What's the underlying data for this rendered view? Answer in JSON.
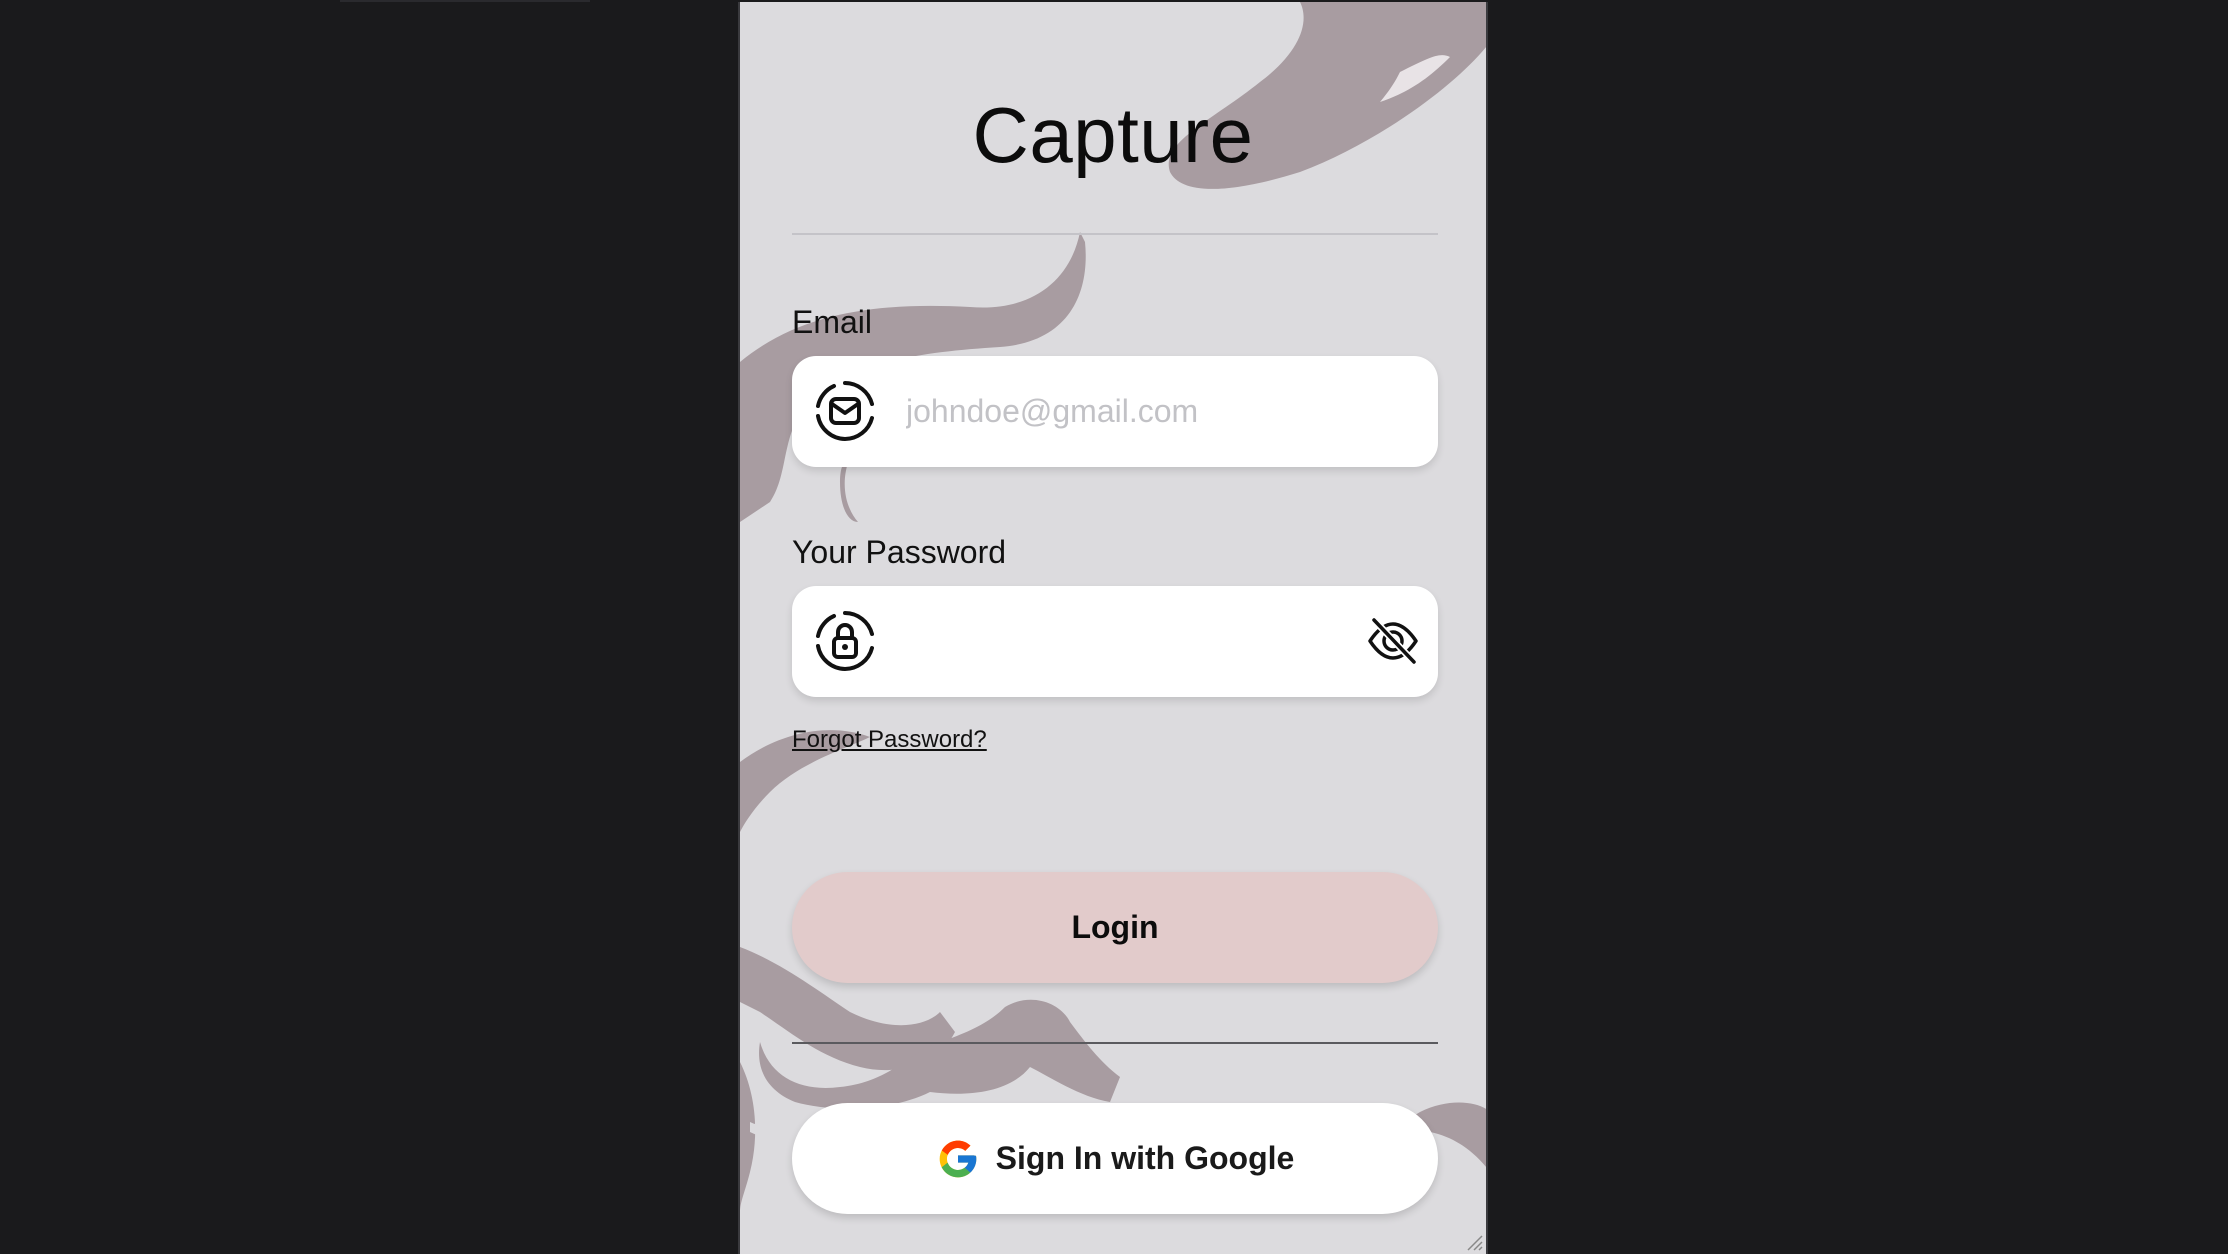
{
  "app": {
    "title": "Capture"
  },
  "form": {
    "email_label": "Email",
    "email_placeholder": "johndoe@gmail.com",
    "email_value": "",
    "password_label": "Your Password",
    "password_value": "",
    "forgot_password": "Forgot Password?",
    "login_label": "Login",
    "google_label": "Sign In with Google"
  },
  "icons": {
    "email": "mail-icon",
    "password": "lock-icon",
    "visibility": "eye-off-icon",
    "google": "google-logo-icon"
  },
  "colors": {
    "background": "#dcdbde",
    "swirl": "#a89ca1",
    "login_button": "#e2cbcb",
    "field": "#ffffff",
    "outer": "#1a1a1c"
  }
}
